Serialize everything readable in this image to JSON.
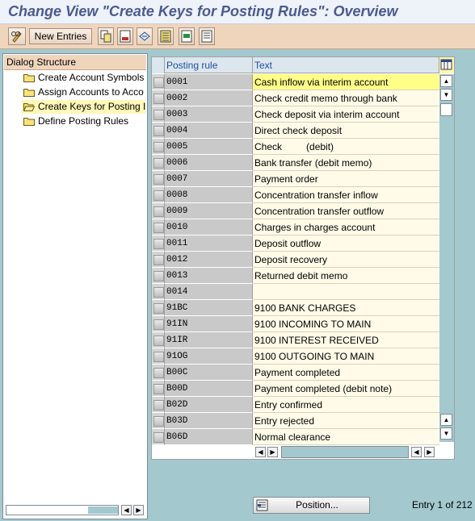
{
  "window": {
    "title": "Change View \"Create Keys for Posting Rules\": Overview"
  },
  "toolbar": {
    "buttons": [
      {
        "icon": "pencil-glasses-icon",
        "name": "display-change-button"
      },
      {
        "label": "New Entries",
        "name": "new-entries-button"
      },
      {
        "icon": "copy-icon",
        "name": "copy-as-button"
      },
      {
        "icon": "delete-icon",
        "name": "delete-button"
      },
      {
        "icon": "undo-change-icon",
        "name": "undo-change-button"
      },
      {
        "icon": "select-all-icon",
        "name": "select-all-button"
      },
      {
        "icon": "select-block-icon",
        "name": "select-block-button"
      },
      {
        "icon": "deselect-all-icon",
        "name": "deselect-all-button"
      }
    ]
  },
  "dialog_structure": {
    "header": "Dialog Structure",
    "items": [
      {
        "label": "Create Account Symbols",
        "selected": false
      },
      {
        "label": "Assign Accounts to Acco",
        "selected": false
      },
      {
        "label": "Create Keys for Posting I",
        "selected": true
      },
      {
        "label": "Define Posting Rules",
        "selected": false
      }
    ]
  },
  "table": {
    "columns": [
      "Posting rule",
      "Text"
    ],
    "rows": [
      {
        "rule": "0001",
        "text": "Cash inflow via interim account",
        "highlight": true
      },
      {
        "rule": "0002",
        "text": "Check credit memo through bank"
      },
      {
        "rule": "0003",
        "text": "Check deposit via interim account"
      },
      {
        "rule": "0004",
        "text": "Direct check deposit"
      },
      {
        "rule": "0005",
        "text": "Check         (debit)"
      },
      {
        "rule": "0006",
        "text": "Bank transfer (debit memo)"
      },
      {
        "rule": "0007",
        "text": "Payment order"
      },
      {
        "rule": "0008",
        "text": "Concentration transfer inflow"
      },
      {
        "rule": "0009",
        "text": "Concentration transfer outflow"
      },
      {
        "rule": "0010",
        "text": "Charges in charges account"
      },
      {
        "rule": "0011",
        "text": "Deposit outflow"
      },
      {
        "rule": "0012",
        "text": "Deposit recovery"
      },
      {
        "rule": "0013",
        "text": "Returned debit memo"
      },
      {
        "rule": "0014",
        "text": ""
      },
      {
        "rule": "91BC",
        "text": "9100 BANK CHARGES"
      },
      {
        "rule": "91IN",
        "text": "9100 INCOMING TO MAIN"
      },
      {
        "rule": "91IR",
        "text": "9100 INTEREST RECEIVED"
      },
      {
        "rule": "91OG",
        "text": "9100 OUTGOING TO MAIN"
      },
      {
        "rule": "B00C",
        "text": "Payment completed"
      },
      {
        "rule": "B00D",
        "text": "Payment completed (debit note)"
      },
      {
        "rule": "B02D",
        "text": "Entry confirmed"
      },
      {
        "rule": "B03D",
        "text": "Entry rejected"
      },
      {
        "rule": "B06D",
        "text": "Normal clearance"
      }
    ]
  },
  "footer": {
    "position_label": "Position...",
    "entry_info": "Entry 1 of 212"
  },
  "colors": {
    "title": "#4b5a8e",
    "toolbar": "#f0d5bd",
    "background": "#a3c9cf",
    "highlight_cell": "#ffff88",
    "key_cell": "#c9c9c9"
  }
}
